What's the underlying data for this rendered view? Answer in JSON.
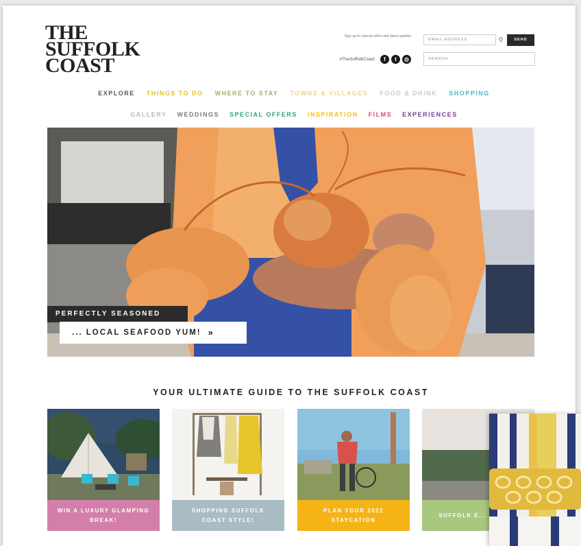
{
  "brand": {
    "logo_lines": [
      "THE",
      "SUFFOLK",
      "COAST"
    ]
  },
  "header": {
    "promo_text": "Sign up for special offers and latest updates",
    "hashtag": "#TheSuffolkCoast",
    "social": [
      {
        "name": "facebook-icon",
        "glyph": "f"
      },
      {
        "name": "twitter-icon",
        "glyph": "t"
      },
      {
        "name": "instagram-icon",
        "glyph": "◎"
      }
    ],
    "email_placeholder": "EMAIL ADDRESS",
    "send_label": "SEND",
    "search_placeholder": "SEARCH"
  },
  "nav": {
    "row1": [
      {
        "label": "EXPLORE",
        "color": "#555555"
      },
      {
        "label": "THINGS TO DO",
        "color": "#e0c21a"
      },
      {
        "label": "WHERE TO STAY",
        "color": "#9bb36a"
      },
      {
        "label": "TOWNS & VILLAGES",
        "color": "#e7d58a"
      },
      {
        "label": "FOOD & DRINK",
        "color": "#c9c9c9"
      },
      {
        "label": "SHOPPING",
        "color": "#48b6c8"
      }
    ],
    "row2": [
      {
        "label": "GALLERY",
        "color": "#b9b9b9"
      },
      {
        "label": "WEDDINGS",
        "color": "#7a7a7a"
      },
      {
        "label": "SPECIAL OFFERS",
        "color": "#2fa27a"
      },
      {
        "label": "INSPIRATION",
        "color": "#eec21b"
      },
      {
        "label": "FILMS",
        "color": "#d05070"
      },
      {
        "label": "EXPERIENCES",
        "color": "#7a3c8c"
      }
    ]
  },
  "hero": {
    "tag1": "PERFECTLY SEASONED",
    "tag2": "... LOCAL SEAFOOD YUM!",
    "arrow": "»"
  },
  "guide": {
    "heading": "YOUR ULTIMATE GUIDE TO THE SUFFOLK COAST",
    "cards": [
      {
        "caption": "WIN A LUXURY GLAMPING BREAK!",
        "color": "#d47fa9"
      },
      {
        "caption": "SHOPPING SUFFOLK COAST STYLE!",
        "color": "#a9bcc3"
      },
      {
        "caption": "PLAN YOUR 2022 STAYCATION",
        "color": "#f5b316"
      },
      {
        "caption": "SUFFOLK E... SUMM...",
        "color": "#a8c77f"
      }
    ]
  }
}
